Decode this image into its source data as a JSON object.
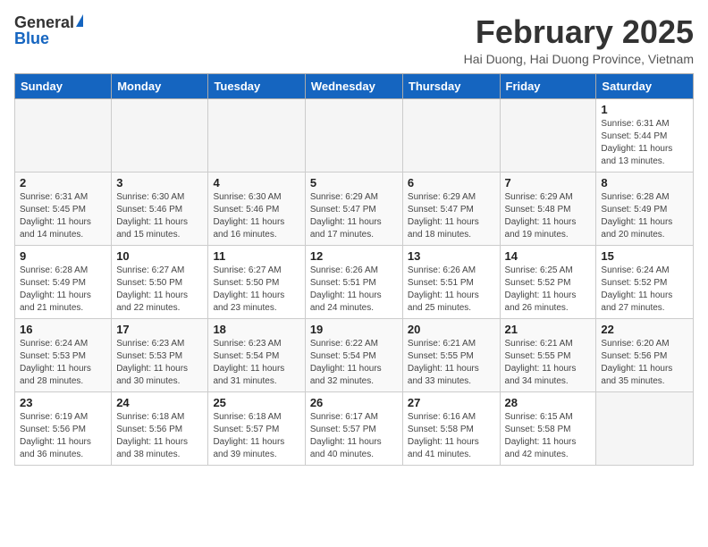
{
  "header": {
    "logo_general": "General",
    "logo_blue": "Blue",
    "month_year": "February 2025",
    "location": "Hai Duong, Hai Duong Province, Vietnam"
  },
  "weekdays": [
    "Sunday",
    "Monday",
    "Tuesday",
    "Wednesday",
    "Thursday",
    "Friday",
    "Saturday"
  ],
  "weeks": [
    [
      {
        "day": "",
        "sunrise": "",
        "sunset": "",
        "daylight": "",
        "empty": true
      },
      {
        "day": "",
        "sunrise": "",
        "sunset": "",
        "daylight": "",
        "empty": true
      },
      {
        "day": "",
        "sunrise": "",
        "sunset": "",
        "daylight": "",
        "empty": true
      },
      {
        "day": "",
        "sunrise": "",
        "sunset": "",
        "daylight": "",
        "empty": true
      },
      {
        "day": "",
        "sunrise": "",
        "sunset": "",
        "daylight": "",
        "empty": true
      },
      {
        "day": "",
        "sunrise": "",
        "sunset": "",
        "daylight": "",
        "empty": true
      },
      {
        "day": "1",
        "sunrise": "Sunrise: 6:31 AM",
        "sunset": "Sunset: 5:44 PM",
        "daylight": "Daylight: 11 hours and 13 minutes.",
        "empty": false
      }
    ],
    [
      {
        "day": "2",
        "sunrise": "Sunrise: 6:31 AM",
        "sunset": "Sunset: 5:45 PM",
        "daylight": "Daylight: 11 hours and 14 minutes.",
        "empty": false
      },
      {
        "day": "3",
        "sunrise": "Sunrise: 6:30 AM",
        "sunset": "Sunset: 5:46 PM",
        "daylight": "Daylight: 11 hours and 15 minutes.",
        "empty": false
      },
      {
        "day": "4",
        "sunrise": "Sunrise: 6:30 AM",
        "sunset": "Sunset: 5:46 PM",
        "daylight": "Daylight: 11 hours and 16 minutes.",
        "empty": false
      },
      {
        "day": "5",
        "sunrise": "Sunrise: 6:29 AM",
        "sunset": "Sunset: 5:47 PM",
        "daylight": "Daylight: 11 hours and 17 minutes.",
        "empty": false
      },
      {
        "day": "6",
        "sunrise": "Sunrise: 6:29 AM",
        "sunset": "Sunset: 5:47 PM",
        "daylight": "Daylight: 11 hours and 18 minutes.",
        "empty": false
      },
      {
        "day": "7",
        "sunrise": "Sunrise: 6:29 AM",
        "sunset": "Sunset: 5:48 PM",
        "daylight": "Daylight: 11 hours and 19 minutes.",
        "empty": false
      },
      {
        "day": "8",
        "sunrise": "Sunrise: 6:28 AM",
        "sunset": "Sunset: 5:49 PM",
        "daylight": "Daylight: 11 hours and 20 minutes.",
        "empty": false
      }
    ],
    [
      {
        "day": "9",
        "sunrise": "Sunrise: 6:28 AM",
        "sunset": "Sunset: 5:49 PM",
        "daylight": "Daylight: 11 hours and 21 minutes.",
        "empty": false
      },
      {
        "day": "10",
        "sunrise": "Sunrise: 6:27 AM",
        "sunset": "Sunset: 5:50 PM",
        "daylight": "Daylight: 11 hours and 22 minutes.",
        "empty": false
      },
      {
        "day": "11",
        "sunrise": "Sunrise: 6:27 AM",
        "sunset": "Sunset: 5:50 PM",
        "daylight": "Daylight: 11 hours and 23 minutes.",
        "empty": false
      },
      {
        "day": "12",
        "sunrise": "Sunrise: 6:26 AM",
        "sunset": "Sunset: 5:51 PM",
        "daylight": "Daylight: 11 hours and 24 minutes.",
        "empty": false
      },
      {
        "day": "13",
        "sunrise": "Sunrise: 6:26 AM",
        "sunset": "Sunset: 5:51 PM",
        "daylight": "Daylight: 11 hours and 25 minutes.",
        "empty": false
      },
      {
        "day": "14",
        "sunrise": "Sunrise: 6:25 AM",
        "sunset": "Sunset: 5:52 PM",
        "daylight": "Daylight: 11 hours and 26 minutes.",
        "empty": false
      },
      {
        "day": "15",
        "sunrise": "Sunrise: 6:24 AM",
        "sunset": "Sunset: 5:52 PM",
        "daylight": "Daylight: 11 hours and 27 minutes.",
        "empty": false
      }
    ],
    [
      {
        "day": "16",
        "sunrise": "Sunrise: 6:24 AM",
        "sunset": "Sunset: 5:53 PM",
        "daylight": "Daylight: 11 hours and 28 minutes.",
        "empty": false
      },
      {
        "day": "17",
        "sunrise": "Sunrise: 6:23 AM",
        "sunset": "Sunset: 5:53 PM",
        "daylight": "Daylight: 11 hours and 30 minutes.",
        "empty": false
      },
      {
        "day": "18",
        "sunrise": "Sunrise: 6:23 AM",
        "sunset": "Sunset: 5:54 PM",
        "daylight": "Daylight: 11 hours and 31 minutes.",
        "empty": false
      },
      {
        "day": "19",
        "sunrise": "Sunrise: 6:22 AM",
        "sunset": "Sunset: 5:54 PM",
        "daylight": "Daylight: 11 hours and 32 minutes.",
        "empty": false
      },
      {
        "day": "20",
        "sunrise": "Sunrise: 6:21 AM",
        "sunset": "Sunset: 5:55 PM",
        "daylight": "Daylight: 11 hours and 33 minutes.",
        "empty": false
      },
      {
        "day": "21",
        "sunrise": "Sunrise: 6:21 AM",
        "sunset": "Sunset: 5:55 PM",
        "daylight": "Daylight: 11 hours and 34 minutes.",
        "empty": false
      },
      {
        "day": "22",
        "sunrise": "Sunrise: 6:20 AM",
        "sunset": "Sunset: 5:56 PM",
        "daylight": "Daylight: 11 hours and 35 minutes.",
        "empty": false
      }
    ],
    [
      {
        "day": "23",
        "sunrise": "Sunrise: 6:19 AM",
        "sunset": "Sunset: 5:56 PM",
        "daylight": "Daylight: 11 hours and 36 minutes.",
        "empty": false
      },
      {
        "day": "24",
        "sunrise": "Sunrise: 6:18 AM",
        "sunset": "Sunset: 5:56 PM",
        "daylight": "Daylight: 11 hours and 38 minutes.",
        "empty": false
      },
      {
        "day": "25",
        "sunrise": "Sunrise: 6:18 AM",
        "sunset": "Sunset: 5:57 PM",
        "daylight": "Daylight: 11 hours and 39 minutes.",
        "empty": false
      },
      {
        "day": "26",
        "sunrise": "Sunrise: 6:17 AM",
        "sunset": "Sunset: 5:57 PM",
        "daylight": "Daylight: 11 hours and 40 minutes.",
        "empty": false
      },
      {
        "day": "27",
        "sunrise": "Sunrise: 6:16 AM",
        "sunset": "Sunset: 5:58 PM",
        "daylight": "Daylight: 11 hours and 41 minutes.",
        "empty": false
      },
      {
        "day": "28",
        "sunrise": "Sunrise: 6:15 AM",
        "sunset": "Sunset: 5:58 PM",
        "daylight": "Daylight: 11 hours and 42 minutes.",
        "empty": false
      },
      {
        "day": "",
        "sunrise": "",
        "sunset": "",
        "daylight": "",
        "empty": true
      }
    ]
  ]
}
